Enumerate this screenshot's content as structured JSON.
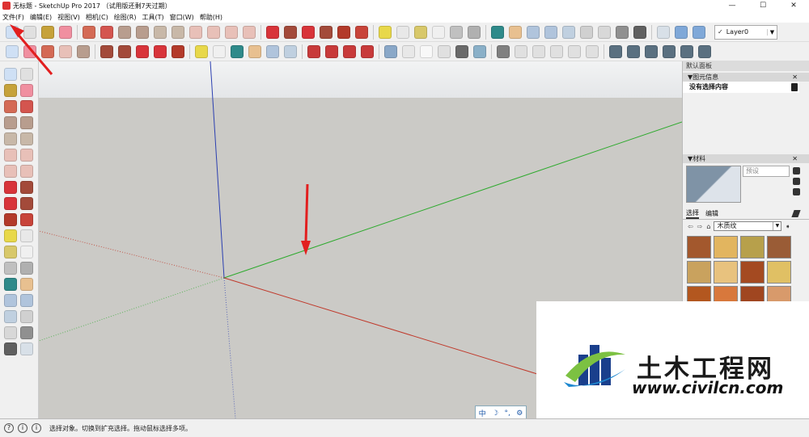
{
  "window": {
    "title": "无标题 - SketchUp Pro 2017 （试用版还剩7天过期）",
    "btn_min": "—",
    "btn_max": "☐",
    "btn_close": "✕"
  },
  "menu": [
    "文件(F)",
    "编辑(E)",
    "视图(V)",
    "相机(C)",
    "绘图(R)",
    "工具(T)",
    "窗口(W)",
    "帮助(H)"
  ],
  "toolbar": {
    "layer": "Layer0",
    "layer_check": "✓"
  },
  "tray": {
    "title": "默认面板",
    "entity_info": {
      "header": "图元信息",
      "value": "没有选择内容"
    },
    "materials": {
      "header": "材料",
      "name_placeholder": "预设",
      "tab_select": "选择",
      "tab_edit": "编辑",
      "library": "木质纹",
      "swatches": [
        "#a3582d",
        "#e2b55f",
        "#b7a04b",
        "#9a5c36",
        "#c9a25e",
        "#e8c27e",
        "#a44a21",
        "#e0c064",
        "#b3571f",
        "#d8783c",
        "#a04620",
        "#d89a6b"
      ]
    }
  },
  "watermark": {
    "site_cn": "土木工程网",
    "url": "www.civilcn.com"
  },
  "ime": {
    "lang": "中",
    "moon": "☽",
    "dot": "°,",
    "gear": "⚙"
  },
  "status": {
    "text": "选择对象。切换到扩充选择。拖动鼠标选择多项。",
    "icon1": "?",
    "icon2": "i",
    "icon3": "i"
  },
  "colors": {
    "axis_red": "#c0392b",
    "axis_green": "#2eaa2e",
    "axis_blue": "#2b3fb0",
    "arrow_red": "#e21f1f",
    "ground": "#cbcac6"
  }
}
